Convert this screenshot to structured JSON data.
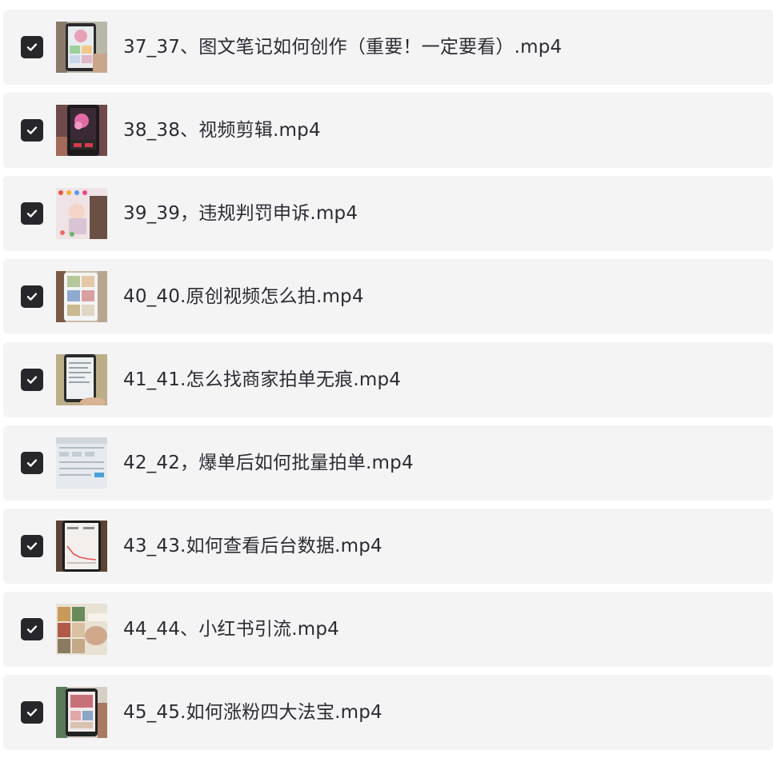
{
  "file_list": {
    "items": [
      {
        "checked": true,
        "name": "37_37、图文笔记如何创作（重要！一定要看）.mp4",
        "thumbnail": "phone-video-thumbnail"
      },
      {
        "checked": true,
        "name": "38_38、视频剪辑.mp4",
        "thumbnail": "phone-video-thumbnail"
      },
      {
        "checked": true,
        "name": "39_39，违规判罚申诉.mp4",
        "thumbnail": "phone-video-thumbnail"
      },
      {
        "checked": true,
        "name": "40_40.原创视频怎么拍.mp4",
        "thumbnail": "phone-video-thumbnail"
      },
      {
        "checked": true,
        "name": "41_41.怎么找商家拍单无痕.mp4",
        "thumbnail": "phone-video-thumbnail"
      },
      {
        "checked": true,
        "name": "42_42，爆单后如何批量拍单.mp4",
        "thumbnail": "screen-video-thumbnail"
      },
      {
        "checked": true,
        "name": "43_43.如何查看后台数据.mp4",
        "thumbnail": "phone-video-thumbnail"
      },
      {
        "checked": true,
        "name": "44_44、小红书引流.mp4",
        "thumbnail": "phone-video-thumbnail"
      },
      {
        "checked": true,
        "name": "45_45.如何涨粉四大法宝.mp4",
        "thumbnail": "phone-video-thumbnail"
      }
    ]
  },
  "colors": {
    "row_background": "#f4f4f5",
    "checkbox_fill": "#26262b",
    "text": "#2b2b33"
  }
}
